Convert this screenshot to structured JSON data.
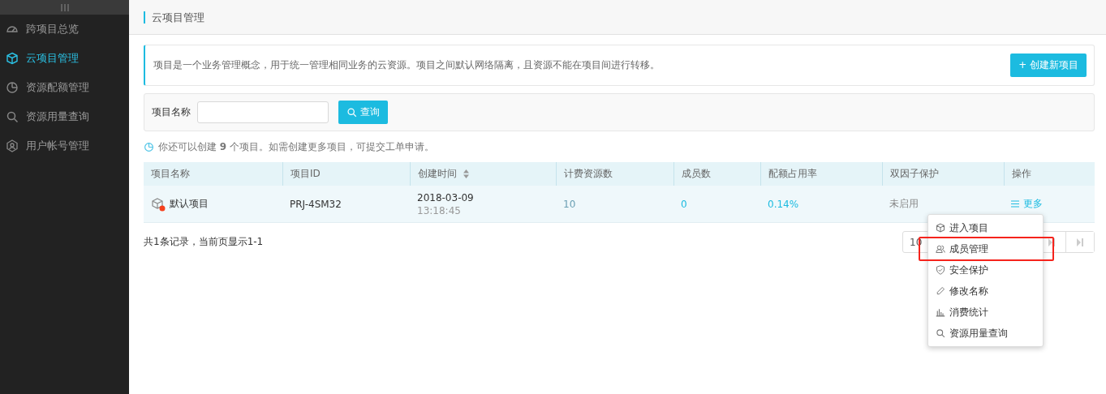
{
  "sidebar": {
    "items": [
      {
        "label": "跨项目总览",
        "selected": false
      },
      {
        "label": "云项目管理",
        "selected": true
      },
      {
        "label": "资源配额管理",
        "selected": false
      },
      {
        "label": "资源用量查询",
        "selected": false
      },
      {
        "label": "用户帐号管理",
        "selected": false
      }
    ]
  },
  "header": {
    "title": "云项目管理"
  },
  "notice": {
    "text": "项目是一个业务管理概念，用于统一管理相同业务的云资源。项目之间默认网络隔离，且资源不能在项目间进行转移。",
    "create_button": "+ 创建新项目"
  },
  "search": {
    "label": "项目名称",
    "button": "查询"
  },
  "quota_hint": "你还可以创建 **9** 个项目。如需创建更多项目，可提交工单申请。",
  "table": {
    "columns": [
      {
        "label": "项目名称"
      },
      {
        "label": "项目ID"
      },
      {
        "label": "创建时间",
        "sortable": true
      },
      {
        "label": "计费资源数"
      },
      {
        "label": "成员数"
      },
      {
        "label": "配额占用率"
      },
      {
        "label": "双因子保护"
      },
      {
        "label": "操作"
      }
    ],
    "rows": [
      {
        "name": "默认项目",
        "id": "PRJ-4SM32",
        "date": "2018-03-09",
        "time": "13:18:45",
        "resources": "10",
        "members": "0",
        "quota": "0.14%",
        "two_factor": "未启用",
        "action": "更多"
      }
    ]
  },
  "footer": {
    "summary": "共1条记录，当前页显示1-1",
    "page_size": "10"
  },
  "menu": {
    "items": [
      {
        "label": "进入项目",
        "highlighted": false
      },
      {
        "label": "成员管理",
        "highlighted": true
      },
      {
        "label": "安全保护",
        "highlighted": false
      },
      {
        "label": "修改名称",
        "highlighted": false
      },
      {
        "label": "消费统计",
        "highlighted": false
      },
      {
        "label": "资源用量查询",
        "highlighted": false
      }
    ]
  }
}
